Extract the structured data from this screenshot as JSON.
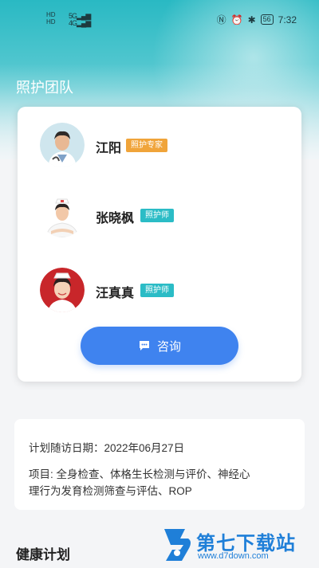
{
  "status_bar": {
    "left_labels": [
      "HD",
      "HD"
    ],
    "signal_text": "5G",
    "signal2_text": "4G",
    "battery": "56",
    "time": "7:32"
  },
  "page": {
    "title": "照护团队"
  },
  "team": {
    "members": [
      {
        "name": "江阳",
        "role": "照护专家",
        "role_color": "#f0a43a"
      },
      {
        "name": "张晓枫",
        "role": "照护师",
        "role_color": "#2bbcc6"
      },
      {
        "name": "汪真真",
        "role": "照护师",
        "role_color": "#2bbcc6"
      }
    ],
    "consult_label": "咨询"
  },
  "plan": {
    "visit_date": "计划随访日期：2022年06月27日",
    "items_line1": "项目: 全身检查、体格生长检测与评价、神经心",
    "items_line2": "理行为发育检测筛查与评估、ROP"
  },
  "health_plan": {
    "title": "健康计划"
  },
  "watermark": {
    "brand": "第七下载站",
    "url": "www.d7down.com"
  },
  "colors": {
    "accent_blue": "#3f83ef",
    "teal": "#2bbcc6",
    "orange": "#f0a43a"
  }
}
